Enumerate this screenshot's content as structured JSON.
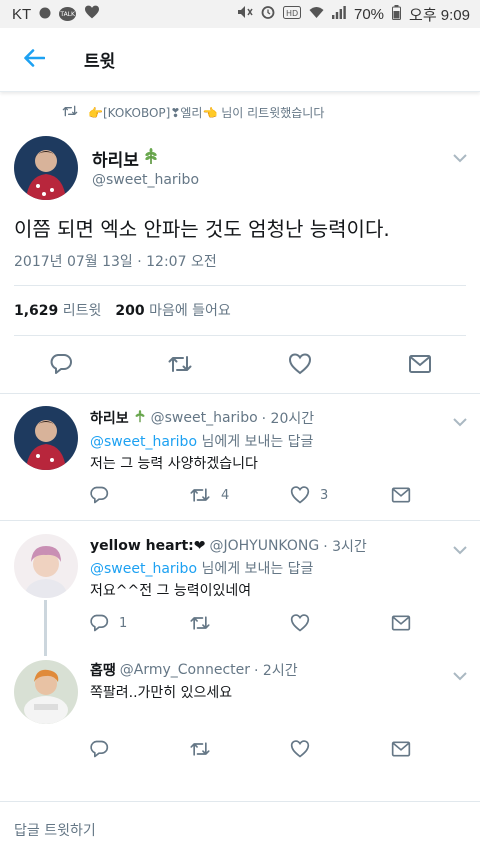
{
  "status_bar": {
    "carrier": "KT",
    "talk_label": "TALK",
    "battery_percent": "70%",
    "time": "오후 9:09"
  },
  "header": {
    "title": "트윗"
  },
  "retweet_context": {
    "text": "👉[KOKOBOP]❣엘리👈 님이 리트윗했습니다"
  },
  "tweet": {
    "author_name": "하리보",
    "author_handle": "@sweet_haribo",
    "text": "이쯤 되면 엑소 안파는 것도 엄청난 능력이다.",
    "timestamp": "2017년 07월 13일 · 12:07 오전",
    "retweets_count": "1,629",
    "retweets_label": "리트윗",
    "likes_count": "200",
    "likes_label": "마음에 들어요"
  },
  "replies": [
    {
      "name": "하리보",
      "handle": "@sweet_haribo",
      "time": "· 20시간",
      "replying_to": "@sweet_haribo",
      "replying_suffix": "님에게 보내는 답글",
      "text": "저는 그 능력 사양하겠습니다",
      "reply_count": "",
      "retweet_count": "4",
      "like_count": "3"
    },
    {
      "name": "yellow heart:❤",
      "handle": "@JOHYUNKONG",
      "time": "· 3시간",
      "replying_to": "@sweet_haribo",
      "replying_suffix": "님에게 보내는 답글",
      "text": "저요^^전  그 능력이있네여",
      "reply_count": "1",
      "retweet_count": "",
      "like_count": ""
    },
    {
      "name": "홉땡",
      "handle": "@Army_Connecter",
      "time": "· 2시간",
      "text": "쪽팔려..가만히 있으세요",
      "reply_count": "",
      "retweet_count": "",
      "like_count": ""
    }
  ],
  "footer": {
    "reply_prompt": "답글 트윗하기"
  },
  "colors": {
    "accent": "#1da1f2",
    "secondary_text": "#657786",
    "divider": "#e1e8ed"
  }
}
